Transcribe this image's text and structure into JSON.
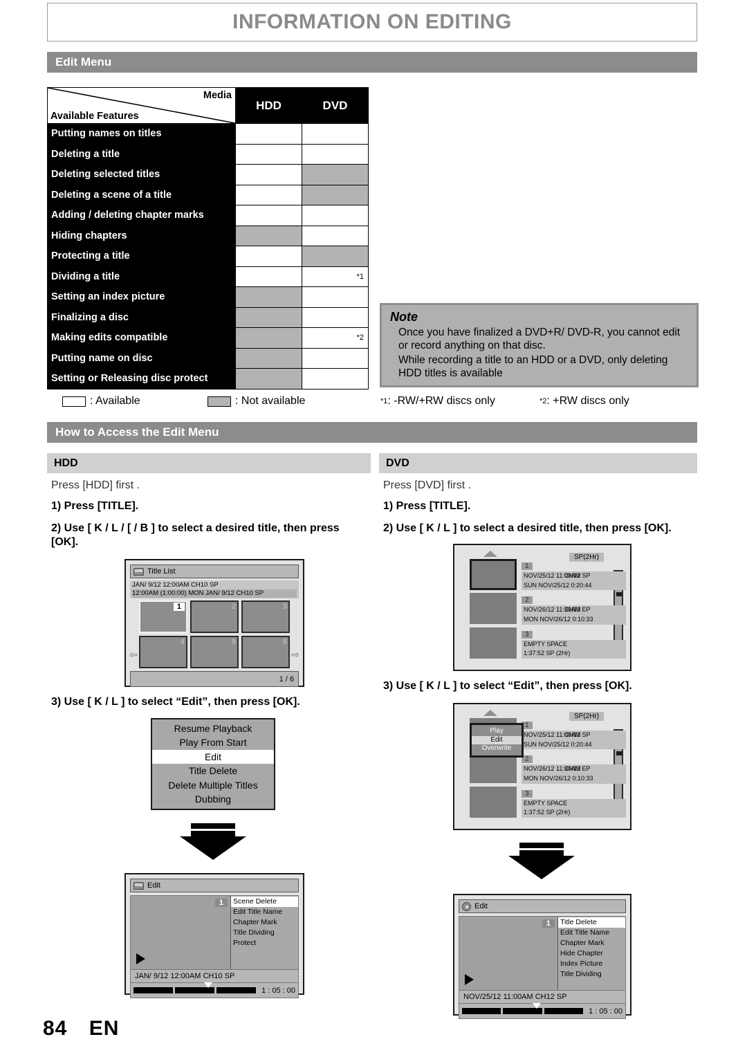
{
  "page": {
    "title": "INFORMATION ON EDITING",
    "footer_page_number": "84",
    "footer_lang": "EN"
  },
  "section_bars": {
    "edit_menu": "Edit Menu",
    "how_to_access": "How to Access the Edit Menu"
  },
  "feature_table": {
    "corner_media_label": "Media",
    "corner_features_label": "Available Features",
    "columns": [
      "HDD",
      "DVD"
    ],
    "rows": [
      {
        "feature": "Putting names on titles",
        "hdd": "yes",
        "dvd": "yes",
        "hdd_note": "",
        "dvd_note": ""
      },
      {
        "feature": "Deleting a title",
        "hdd": "yes",
        "dvd": "yes",
        "hdd_note": "",
        "dvd_note": ""
      },
      {
        "feature": "Deleting selected titles",
        "hdd": "yes",
        "dvd": "no",
        "hdd_note": "",
        "dvd_note": ""
      },
      {
        "feature": "Deleting a scene of a title",
        "hdd": "yes",
        "dvd": "no",
        "hdd_note": "",
        "dvd_note": ""
      },
      {
        "feature": "Adding / deleting chapter marks",
        "hdd": "yes",
        "dvd": "yes",
        "hdd_note": "",
        "dvd_note": ""
      },
      {
        "feature": "Hiding chapters",
        "hdd": "no",
        "dvd": "yes",
        "hdd_note": "",
        "dvd_note": ""
      },
      {
        "feature": "Protecting a title",
        "hdd": "yes",
        "dvd": "no",
        "hdd_note": "",
        "dvd_note": ""
      },
      {
        "feature": "Dividing a title",
        "hdd": "yes",
        "dvd": "yes",
        "hdd_note": "",
        "dvd_note": "*1"
      },
      {
        "feature": "Setting an index picture",
        "hdd": "no",
        "dvd": "yes",
        "hdd_note": "",
        "dvd_note": ""
      },
      {
        "feature": "Finalizing a disc",
        "hdd": "no",
        "dvd": "yes",
        "hdd_note": "",
        "dvd_note": ""
      },
      {
        "feature": "Making edits compatible",
        "hdd": "no",
        "dvd": "yes",
        "hdd_note": "",
        "dvd_note": "*2"
      },
      {
        "feature": "Putting name on disc",
        "hdd": "no",
        "dvd": "yes",
        "hdd_note": "",
        "dvd_note": ""
      },
      {
        "feature": "Setting or Releasing disc protect",
        "hdd": "no",
        "dvd": "yes",
        "hdd_note": "",
        "dvd_note": ""
      }
    ]
  },
  "legend": {
    "available": ": Available",
    "not_available": ": Not available",
    "note1_marker": "*1",
    "note1_text": ": -RW/+RW discs only",
    "note2_marker": "*2",
    "note2_text": ": +RW discs only"
  },
  "note": {
    "title": "Note",
    "line1": "Once you have finalized a DVD+R/ DVD-R, you cannot edit or record anything on that disc.",
    "line2": "While recording a title to an HDD or a DVD, only deleting HDD titles is available"
  },
  "how_to": {
    "hdd": {
      "heading": "HDD",
      "intro": "Press [HDD] first .",
      "step1": "1) Press [TITLE].",
      "step2": "2) Use [ K / L / [ / B ] to select a desired title, then press [OK].",
      "step3": "3) Use [ K / L ] to select “Edit”, then press [OK]."
    },
    "dvd": {
      "heading": "DVD",
      "intro": "Press [DVD] first .",
      "step1": "1) Press [TITLE].",
      "step2": "2) Use [ K / L ] to select a desired title, then press [OK].",
      "step3": "3) Use [ K / L ] to select “Edit”, then press [OK]."
    }
  },
  "hdd_title_list": {
    "window_title": "Title List",
    "info_line1": "JAN/ 9/12 12:00AM  CH10  SP",
    "info_line2": "12:00AM (1:00:00)   MON JAN/  9/12   CH10   SP",
    "thumbs": [
      "1",
      "2",
      "3",
      "4",
      "5",
      "6"
    ],
    "selected_index": "1",
    "page_indicator": "1 / 6",
    "arrow_left": "⇦",
    "arrow_right": "⇨"
  },
  "hdd_popup_menu": {
    "items": [
      "Resume Playback",
      "Play From Start",
      "Edit",
      "Title Delete",
      "Delete Multiple Titles",
      "Dubbing"
    ],
    "highlighted": "Edit"
  },
  "dvd_title_list": {
    "mode_badge": "SP(2Hr)",
    "entries": [
      {
        "num": "1",
        "line1": "NOV/25/12  11:00AM",
        "line1b": "CH12  SP",
        "line2": "SUN NOV/25/12      0:20:44"
      },
      {
        "num": "2",
        "line1": "NOV/26/12  11:30AM",
        "line1b": "CH13  EP",
        "line2": "MON NOV/26/12      0:10:33"
      },
      {
        "num": "3",
        "line1": "EMPTY SPACE",
        "line1b": "",
        "line2": "1:37:52  SP (2Hr)"
      }
    ]
  },
  "dvd_popup_menu": {
    "items": [
      "Play",
      "Edit",
      "Overwrite"
    ],
    "highlighted": "Edit"
  },
  "hdd_edit_screen": {
    "window_title": "Edit",
    "thumb_num": "1",
    "menu_items": [
      "Scene Delete",
      "Edit Title Name",
      "Chapter Mark",
      "Title Dividing",
      "Protect"
    ],
    "highlighted": "Scene Delete",
    "info": "JAN/ 9/12 12:00AM CH10   SP",
    "time": "1 : 05 : 00"
  },
  "dvd_edit_screen": {
    "window_title": "Edit",
    "thumb_num": "1",
    "menu_items": [
      "Title Delete",
      "Edit Title Name",
      "Chapter Mark",
      "Hide Chapter",
      "Index Picture",
      "Title Dividing"
    ],
    "highlighted": "Title Delete",
    "info": "NOV/25/12 11:00AM CH12 SP",
    "time": "1 : 05 : 00"
  }
}
